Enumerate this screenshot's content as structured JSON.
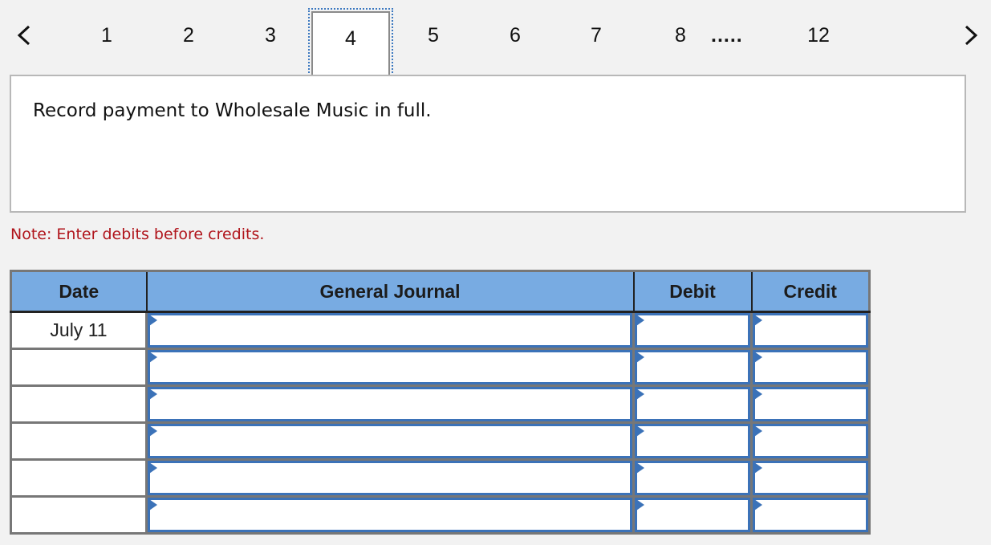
{
  "pagination": {
    "prev_icon": "chevron-left-icon",
    "next_icon": "chevron-right-icon",
    "pages": [
      {
        "label": "1"
      },
      {
        "label": "2"
      },
      {
        "label": "3"
      },
      {
        "label": "4"
      },
      {
        "label": "5"
      },
      {
        "label": "6"
      },
      {
        "label": "7"
      },
      {
        "label": "8"
      }
    ],
    "current": "4",
    "ellipsis": ".....",
    "last_page": "12"
  },
  "question": {
    "text": "Record payment to Wholesale Music in full."
  },
  "note": "Note: Enter debits before credits.",
  "journal": {
    "headers": {
      "date": "Date",
      "general_journal": "General Journal",
      "debit": "Debit",
      "credit": "Credit"
    },
    "rows": [
      {
        "date": "July 11",
        "account": "",
        "debit": "",
        "credit": ""
      },
      {
        "date": "",
        "account": "",
        "debit": "",
        "credit": ""
      },
      {
        "date": "",
        "account": "",
        "debit": "",
        "credit": ""
      },
      {
        "date": "",
        "account": "",
        "debit": "",
        "credit": ""
      },
      {
        "date": "",
        "account": "",
        "debit": "",
        "credit": ""
      },
      {
        "date": "",
        "account": "",
        "debit": "",
        "credit": ""
      }
    ],
    "colors": {
      "header_bg": "#78abe2",
      "input_border": "#3b72b8"
    }
  },
  "colors": {
    "note_text": "#b0141b",
    "page_background": "#f2f2f2"
  }
}
